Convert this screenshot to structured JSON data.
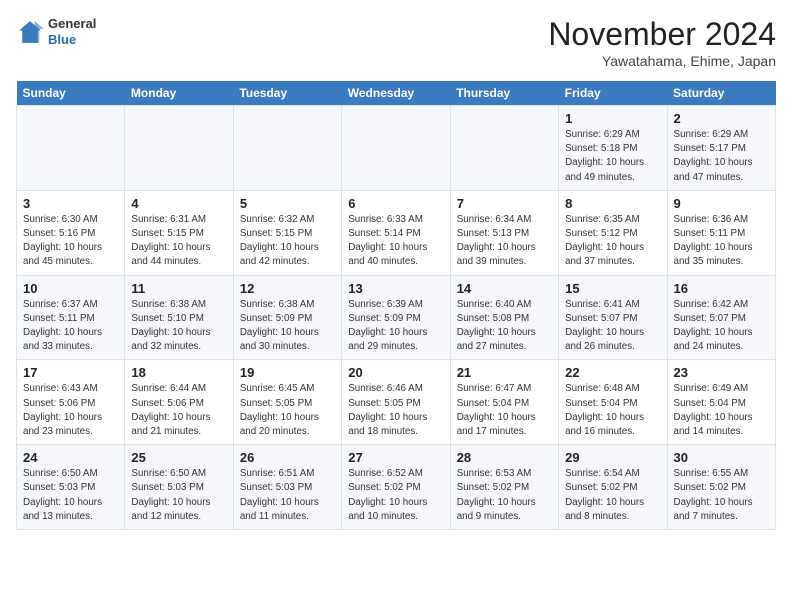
{
  "header": {
    "logo_line1": "General",
    "logo_line2": "Blue",
    "month": "November 2024",
    "location": "Yawatahama, Ehime, Japan"
  },
  "weekdays": [
    "Sunday",
    "Monday",
    "Tuesday",
    "Wednesday",
    "Thursday",
    "Friday",
    "Saturday"
  ],
  "weeks": [
    [
      {
        "day": "",
        "info": ""
      },
      {
        "day": "",
        "info": ""
      },
      {
        "day": "",
        "info": ""
      },
      {
        "day": "",
        "info": ""
      },
      {
        "day": "",
        "info": ""
      },
      {
        "day": "1",
        "info": "Sunrise: 6:29 AM\nSunset: 5:18 PM\nDaylight: 10 hours\nand 49 minutes."
      },
      {
        "day": "2",
        "info": "Sunrise: 6:29 AM\nSunset: 5:17 PM\nDaylight: 10 hours\nand 47 minutes."
      }
    ],
    [
      {
        "day": "3",
        "info": "Sunrise: 6:30 AM\nSunset: 5:16 PM\nDaylight: 10 hours\nand 45 minutes."
      },
      {
        "day": "4",
        "info": "Sunrise: 6:31 AM\nSunset: 5:15 PM\nDaylight: 10 hours\nand 44 minutes."
      },
      {
        "day": "5",
        "info": "Sunrise: 6:32 AM\nSunset: 5:15 PM\nDaylight: 10 hours\nand 42 minutes."
      },
      {
        "day": "6",
        "info": "Sunrise: 6:33 AM\nSunset: 5:14 PM\nDaylight: 10 hours\nand 40 minutes."
      },
      {
        "day": "7",
        "info": "Sunrise: 6:34 AM\nSunset: 5:13 PM\nDaylight: 10 hours\nand 39 minutes."
      },
      {
        "day": "8",
        "info": "Sunrise: 6:35 AM\nSunset: 5:12 PM\nDaylight: 10 hours\nand 37 minutes."
      },
      {
        "day": "9",
        "info": "Sunrise: 6:36 AM\nSunset: 5:11 PM\nDaylight: 10 hours\nand 35 minutes."
      }
    ],
    [
      {
        "day": "10",
        "info": "Sunrise: 6:37 AM\nSunset: 5:11 PM\nDaylight: 10 hours\nand 33 minutes."
      },
      {
        "day": "11",
        "info": "Sunrise: 6:38 AM\nSunset: 5:10 PM\nDaylight: 10 hours\nand 32 minutes."
      },
      {
        "day": "12",
        "info": "Sunrise: 6:38 AM\nSunset: 5:09 PM\nDaylight: 10 hours\nand 30 minutes."
      },
      {
        "day": "13",
        "info": "Sunrise: 6:39 AM\nSunset: 5:09 PM\nDaylight: 10 hours\nand 29 minutes."
      },
      {
        "day": "14",
        "info": "Sunrise: 6:40 AM\nSunset: 5:08 PM\nDaylight: 10 hours\nand 27 minutes."
      },
      {
        "day": "15",
        "info": "Sunrise: 6:41 AM\nSunset: 5:07 PM\nDaylight: 10 hours\nand 26 minutes."
      },
      {
        "day": "16",
        "info": "Sunrise: 6:42 AM\nSunset: 5:07 PM\nDaylight: 10 hours\nand 24 minutes."
      }
    ],
    [
      {
        "day": "17",
        "info": "Sunrise: 6:43 AM\nSunset: 5:06 PM\nDaylight: 10 hours\nand 23 minutes."
      },
      {
        "day": "18",
        "info": "Sunrise: 6:44 AM\nSunset: 5:06 PM\nDaylight: 10 hours\nand 21 minutes."
      },
      {
        "day": "19",
        "info": "Sunrise: 6:45 AM\nSunset: 5:05 PM\nDaylight: 10 hours\nand 20 minutes."
      },
      {
        "day": "20",
        "info": "Sunrise: 6:46 AM\nSunset: 5:05 PM\nDaylight: 10 hours\nand 18 minutes."
      },
      {
        "day": "21",
        "info": "Sunrise: 6:47 AM\nSunset: 5:04 PM\nDaylight: 10 hours\nand 17 minutes."
      },
      {
        "day": "22",
        "info": "Sunrise: 6:48 AM\nSunset: 5:04 PM\nDaylight: 10 hours\nand 16 minutes."
      },
      {
        "day": "23",
        "info": "Sunrise: 6:49 AM\nSunset: 5:04 PM\nDaylight: 10 hours\nand 14 minutes."
      }
    ],
    [
      {
        "day": "24",
        "info": "Sunrise: 6:50 AM\nSunset: 5:03 PM\nDaylight: 10 hours\nand 13 minutes."
      },
      {
        "day": "25",
        "info": "Sunrise: 6:50 AM\nSunset: 5:03 PM\nDaylight: 10 hours\nand 12 minutes."
      },
      {
        "day": "26",
        "info": "Sunrise: 6:51 AM\nSunset: 5:03 PM\nDaylight: 10 hours\nand 11 minutes."
      },
      {
        "day": "27",
        "info": "Sunrise: 6:52 AM\nSunset: 5:02 PM\nDaylight: 10 hours\nand 10 minutes."
      },
      {
        "day": "28",
        "info": "Sunrise: 6:53 AM\nSunset: 5:02 PM\nDaylight: 10 hours\nand 9 minutes."
      },
      {
        "day": "29",
        "info": "Sunrise: 6:54 AM\nSunset: 5:02 PM\nDaylight: 10 hours\nand 8 minutes."
      },
      {
        "day": "30",
        "info": "Sunrise: 6:55 AM\nSunset: 5:02 PM\nDaylight: 10 hours\nand 7 minutes."
      }
    ]
  ]
}
